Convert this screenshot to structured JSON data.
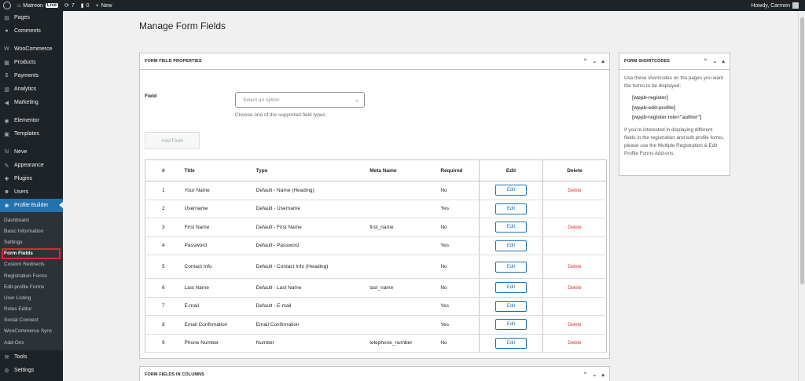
{
  "admin_bar": {
    "site_name": "Matreon",
    "live_badge": "Live",
    "updates_count": "7",
    "comments_count": "0",
    "new_label": "New",
    "greeting": "Howdy, Carmen"
  },
  "sidebar": {
    "items_top": [
      {
        "label": "Pages",
        "icon": "pages-icon",
        "glyph": "▤"
      },
      {
        "label": "Comments",
        "icon": "comments-icon",
        "glyph": "●"
      }
    ],
    "items_woo": [
      {
        "label": "WooCommerce",
        "icon": "woocommerce-icon",
        "glyph": "W"
      },
      {
        "label": "Products",
        "icon": "products-icon",
        "glyph": "▦"
      },
      {
        "label": "Payments",
        "icon": "payments-icon",
        "glyph": "$"
      },
      {
        "label": "Analytics",
        "icon": "analytics-icon",
        "glyph": "▥"
      },
      {
        "label": "Marketing",
        "icon": "marketing-icon",
        "glyph": "◀"
      }
    ],
    "items_el": [
      {
        "label": "Elementor",
        "icon": "elementor-icon",
        "glyph": "◉"
      },
      {
        "label": "Templates",
        "icon": "templates-icon",
        "glyph": "▣"
      }
    ],
    "items_neve": [
      {
        "label": "Neve",
        "icon": "neve-icon",
        "glyph": "N"
      },
      {
        "label": "Appearance",
        "icon": "appearance-icon",
        "glyph": "✎"
      },
      {
        "label": "Plugins",
        "icon": "plugins-icon",
        "glyph": "✚"
      },
      {
        "label": "Users",
        "icon": "users-icon",
        "glyph": "☻"
      }
    ],
    "active_item": {
      "label": "Profile Builder",
      "icon": "profile-builder-icon",
      "glyph": "❀"
    },
    "submenu": [
      "Dashboard",
      "Basic Information",
      "Settings",
      "Form Fields",
      "Custom Redirects",
      "Registration Forms",
      "Edit-profile Forms",
      "User Listing",
      "Roles Editor",
      "Social Connect",
      "WooCommerce Sync",
      "Add-Ons"
    ],
    "items_bottom": [
      {
        "label": "Tools",
        "icon": "tools-icon",
        "glyph": "⚒"
      },
      {
        "label": "Settings",
        "icon": "settings-icon",
        "glyph": "⚙"
      }
    ]
  },
  "main": {
    "page_title": "Manage Form Fields",
    "properties_box": {
      "title": "FORM FIELD PROPERTIES",
      "field_label": "Field",
      "select_placeholder": "Select an option",
      "hint": "Choose one of the supported field types",
      "add_button": "Add Field"
    },
    "table": {
      "headers": [
        "#",
        "Title",
        "Type",
        "Meta Name",
        "Required",
        "Edit",
        "Delete"
      ],
      "rows": [
        {
          "num": "1",
          "title": "Your Name",
          "type": "Default - Name (Heading)",
          "meta": "",
          "required": "No",
          "edit": "Edit",
          "delete": "Delete"
        },
        {
          "num": "2",
          "title": "Username",
          "type": "Default - Username",
          "meta": "",
          "required": "Yes",
          "edit": "Edit",
          "delete": ""
        },
        {
          "num": "3",
          "title": "First Name",
          "type": "Default - First Name",
          "meta": "first_name",
          "required": "No",
          "edit": "Edit",
          "delete": "Delete"
        },
        {
          "num": "4",
          "title": "Password",
          "type": "Default - Password",
          "meta": "",
          "required": "Yes",
          "edit": "Edit",
          "delete": ""
        },
        {
          "num": "5",
          "title": "Contact Info",
          "type": "Default - Contact Info (Heading)",
          "meta": "",
          "required": "No",
          "edit": "Edit",
          "delete": "Delete"
        },
        {
          "num": "6",
          "title": "Last Name",
          "type": "Default - Last Name",
          "meta": "last_name",
          "required": "No",
          "edit": "Edit",
          "delete": "Delete"
        },
        {
          "num": "7",
          "title": "E-mail",
          "type": "Default - E-mail",
          "meta": "",
          "required": "Yes",
          "edit": "Edit",
          "delete": ""
        },
        {
          "num": "8",
          "title": "Email Confirmation",
          "type": "Email Confirmation",
          "meta": "",
          "required": "Yes",
          "edit": "Edit",
          "delete": "Delete"
        },
        {
          "num": "9",
          "title": "Phone Number",
          "type": "Number",
          "meta": "telephone_number",
          "required": "No",
          "edit": "Edit",
          "delete": "Delete"
        }
      ]
    },
    "columns_box": {
      "title": "FORM FIELDS IN COLUMNS"
    },
    "shortcodes_box": {
      "title": "FORM SHORTCODES",
      "intro": "Use these shortcodes on the pages you want the forms to be displayed:",
      "codes": [
        "[wppb-register]",
        "[wppb-edit-profile]",
        "[wppb-register role=\"author\"]"
      ],
      "outro": "If you're interested in displaying different fields in the registration and edit profile forms, please use the Multiple Registration & Edit Profile Forms Add-ons."
    }
  },
  "colors": {
    "admin_dark": "#1d2327",
    "accent": "#2271b1",
    "delete_red": "#d63638",
    "highlight_box": "#e0262f"
  }
}
